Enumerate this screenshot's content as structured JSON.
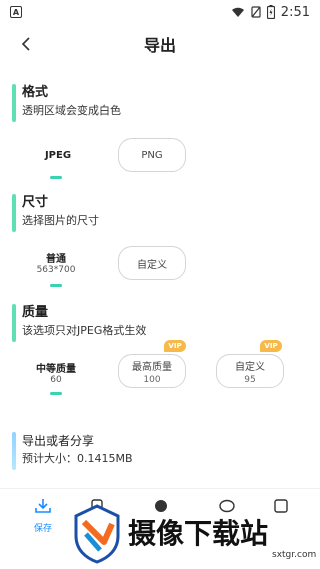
{
  "status": {
    "time": "2:51",
    "left_badge": "A"
  },
  "header": {
    "back_icon": "chevron-left-icon",
    "title": "导出"
  },
  "format": {
    "title": "格式",
    "subtitle": "透明区域会变成白色",
    "options": [
      {
        "label": "JPEG",
        "selected": true
      },
      {
        "label": "PNG",
        "selected": false
      }
    ]
  },
  "size": {
    "title": "尺寸",
    "subtitle": "选择图片的尺寸",
    "options": [
      {
        "label": "普通",
        "value": "563*700",
        "selected": true
      },
      {
        "label": "自定义",
        "selected": false
      }
    ]
  },
  "quality": {
    "title": "质量",
    "subtitle": "该选项只对JPEG格式生效",
    "options": [
      {
        "label": "中等质量",
        "value": "60",
        "selected": true
      },
      {
        "label": "最高质量",
        "value": "100",
        "vip": "VIP",
        "selected": false
      },
      {
        "label": "自定义",
        "value": "95",
        "vip": "VIP",
        "selected": false
      }
    ]
  },
  "export": {
    "title": "导出或者分享",
    "estimate": "预计大小：0.1415MB"
  },
  "bottom": {
    "save_label": "保存"
  },
  "watermark": {
    "text": "摄像下载站",
    "domain": "sxtgr.com"
  },
  "colors": {
    "accent": "#39d3b2",
    "vip": "#f7b948",
    "save": "#1a8cff"
  }
}
